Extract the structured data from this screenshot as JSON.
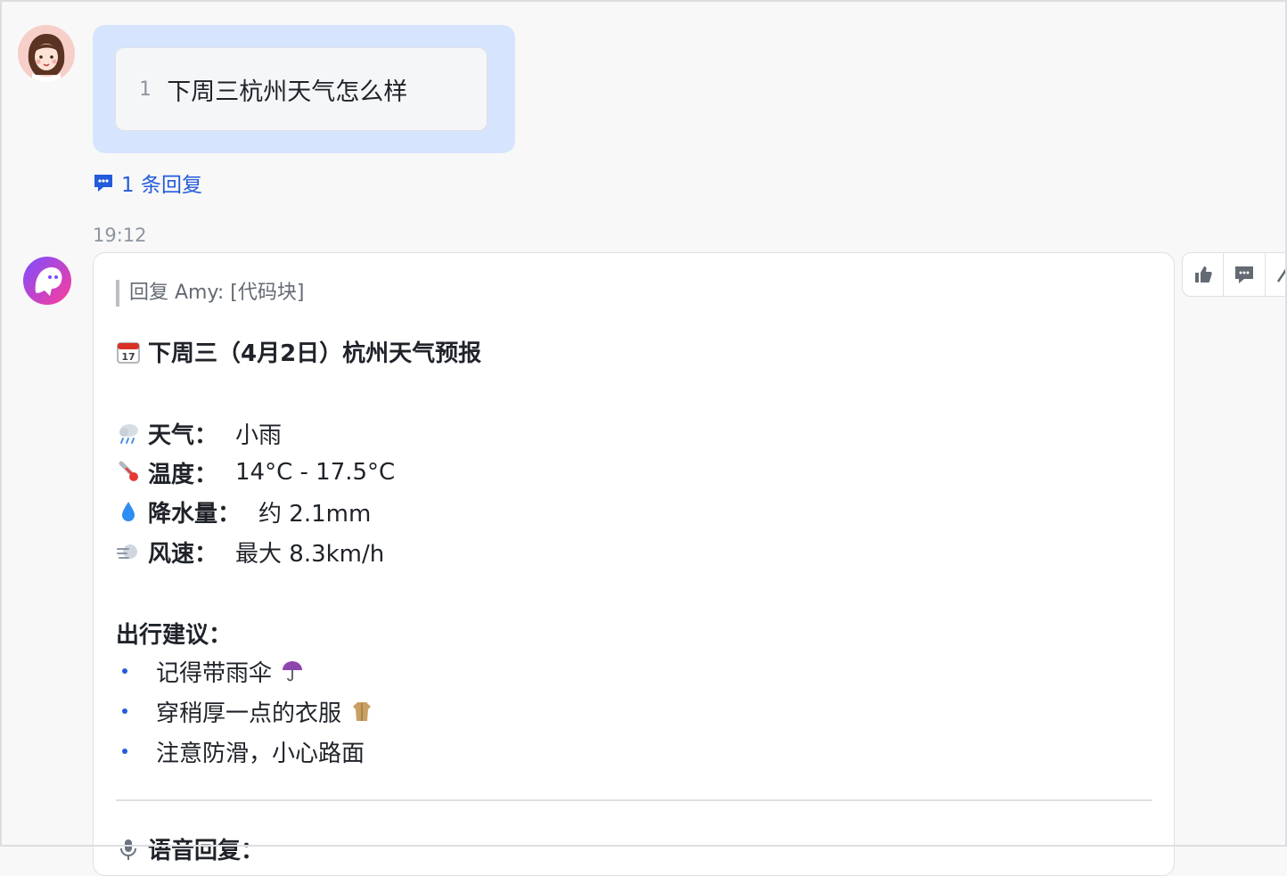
{
  "user_message": {
    "line_number": "1",
    "text": "下周三杭州天气怎么样"
  },
  "reply_link": {
    "label": "1 条回复"
  },
  "timestamp": "19:12",
  "bot_reply": {
    "quote": "回复 Amy: [代码块]",
    "title": "下周三（4月2日）杭州天气预报",
    "rows": [
      {
        "icon": "rain-cloud-icon",
        "label": "天气：",
        "value": "小雨"
      },
      {
        "icon": "thermometer-icon",
        "label": "温度：",
        "value": "14°C - 17.5°C"
      },
      {
        "icon": "droplet-icon",
        "label": "降水量：",
        "value": "约 2.1mm"
      },
      {
        "icon": "wind-icon",
        "label": "风速：",
        "value": "最大 8.3km/h"
      }
    ],
    "suggestion_title": "出行建议：",
    "suggestions": [
      {
        "text": "记得带雨伞",
        "icon": "umbrella-icon"
      },
      {
        "text": "穿稍厚一点的衣服",
        "icon": "coat-icon"
      },
      {
        "text": "注意防滑，小心路面",
        "icon": ""
      }
    ],
    "voice_label": "语音回复："
  },
  "toolbar": {
    "icons": [
      "thumbs-up-icon",
      "comment-icon",
      "more-icon"
    ]
  },
  "colors": {
    "accent": "#245bdb",
    "user_bubble": "#d6e5fd",
    "background": "#f8f8f9"
  }
}
